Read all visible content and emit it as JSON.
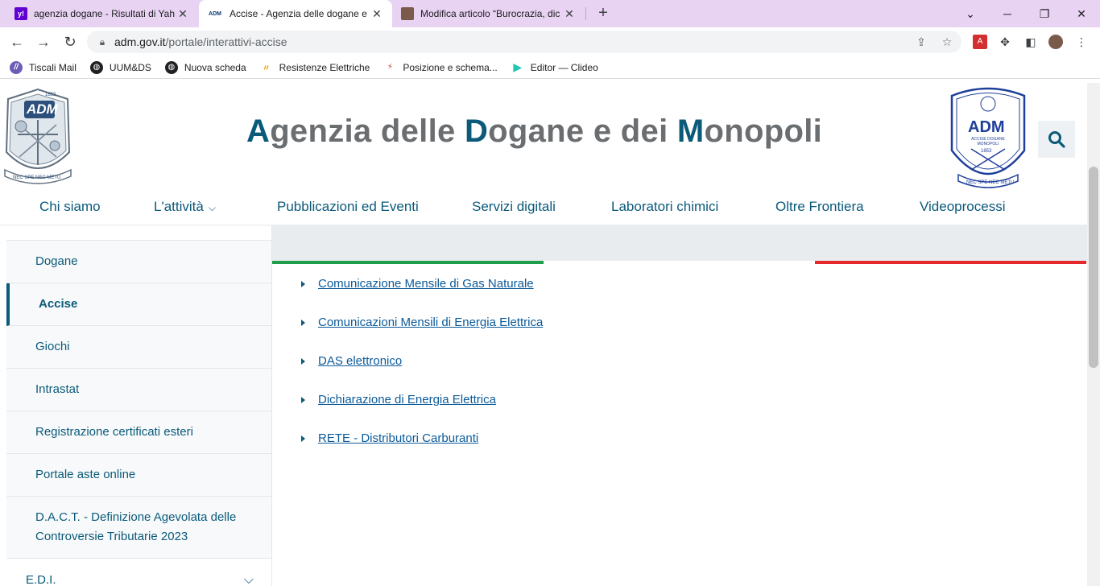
{
  "browser": {
    "tabs": [
      {
        "title": "agenzia dogane - Risultati di Yah",
        "favicon": "yahoo-icon",
        "favicon_text": "y!",
        "active": false
      },
      {
        "title": "Accise - Agenzia delle dogane e d",
        "favicon": "adm-icon",
        "favicon_text": "ADM",
        "active": true
      },
      {
        "title": "Modifica articolo “Burocrazia, dic",
        "favicon": "avatar-icon",
        "favicon_text": "",
        "active": false
      }
    ],
    "new_tab": "+",
    "url_host": "adm.gov.it",
    "url_path": "/portale/interattivi-accise",
    "bookmarks": [
      {
        "label": "Tiscali Mail",
        "icon": "tiscali-icon",
        "color": "#6b5fb5"
      },
      {
        "label": "UUM&DS",
        "icon": "globe-icon",
        "color": "#202124"
      },
      {
        "label": "Nuova scheda",
        "icon": "globe-icon",
        "color": "#202124"
      },
      {
        "label": "Resistenze Elettriche",
        "icon": "resistor-icon",
        "color": "#f29b05"
      },
      {
        "label": "Posizione e schema...",
        "icon": "schema-icon",
        "color": "#c0392b"
      },
      {
        "label": "Editor — Clideo",
        "icon": "play-icon",
        "color": "#1fc7b2"
      }
    ]
  },
  "site": {
    "title_parts": [
      {
        "text": "A",
        "cap": true
      },
      {
        "text": "genzia delle ",
        "cap": false
      },
      {
        "text": "D",
        "cap": true
      },
      {
        "text": "ogane e dei ",
        "cap": false
      },
      {
        "text": "M",
        "cap": true
      },
      {
        "text": "onopoli",
        "cap": false
      }
    ],
    "logo_left_text": "ADM",
    "logo_left_year": "1853",
    "logo_left_motto": "NEC SPE NEC METU",
    "logo_right_text": "ADM",
    "logo_right_sub": "ACCISE DOGANE MONOPOLI",
    "logo_right_year": "1853",
    "logo_right_motto": "NEC SPE NEC METU"
  },
  "nav": {
    "items": [
      {
        "label": "Chi siamo",
        "dropdown": false
      },
      {
        "label": "L'attività",
        "dropdown": true
      },
      {
        "label": "Pubblicazioni ed Eventi",
        "dropdown": false
      },
      {
        "label": "Servizi digitali",
        "dropdown": false
      },
      {
        "label": "Laboratori chimici",
        "dropdown": false
      },
      {
        "label": "Oltre Frontiera",
        "dropdown": false
      },
      {
        "label": "Videoprocessi",
        "dropdown": false
      }
    ]
  },
  "sidebar": {
    "items": [
      {
        "label": "Dogane",
        "active": false
      },
      {
        "label": "Accise",
        "active": true
      },
      {
        "label": "Giochi",
        "active": false
      },
      {
        "label": "Intrastat",
        "active": false
      },
      {
        "label": "Registrazione certificati esteri",
        "active": false
      },
      {
        "label": "Portale aste online",
        "active": false
      },
      {
        "label": "D.A.C.T. - Definizione Agevolata delle Controversie Tributarie 2023",
        "active": false
      },
      {
        "label": "E.D.I.",
        "active": false,
        "expandable": true
      }
    ]
  },
  "content": {
    "links": [
      "Comunicazione Mensile di Gas Naturale",
      "Comunicazioni Mensili di Energia Elettrica",
      "DAS elettronico",
      "Dichiarazione di Energia Elettrica",
      "RETE - Distributori Carburanti"
    ]
  },
  "colors": {
    "brand": "#0b5a7a",
    "title_gray": "#6b6e70",
    "flag_green": "#1e9e4a",
    "flag_red": "#e5282c",
    "tabstrip": "#e9d3f3"
  }
}
